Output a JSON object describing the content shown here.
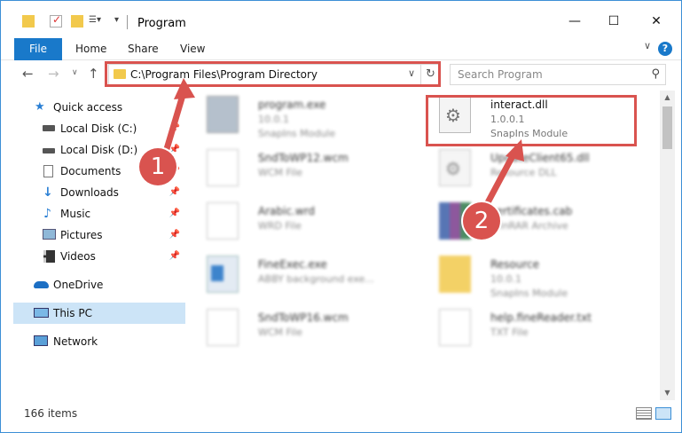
{
  "window": {
    "title": "Program",
    "minimize": "—",
    "maximize": "☐",
    "close": "✕"
  },
  "ribbon": {
    "tabs": [
      "File",
      "Home",
      "Share",
      "View"
    ],
    "help": "?"
  },
  "nav": {
    "address": "C:\\Program Files\\Program Directory",
    "search_placeholder": "Search Program"
  },
  "sidebar": {
    "items": [
      {
        "label": "Quick access",
        "icon": "star-icon",
        "pinned": false
      },
      {
        "label": "Local Disk (C:)",
        "icon": "drive-icon",
        "pinned": true
      },
      {
        "label": "Local Disk (D:)",
        "icon": "drive-icon",
        "pinned": true
      },
      {
        "label": "Documents",
        "icon": "documents-icon",
        "pinned": true
      },
      {
        "label": "Downloads",
        "icon": "download-icon",
        "pinned": true
      },
      {
        "label": "Music",
        "icon": "music-icon",
        "pinned": true
      },
      {
        "label": "Pictures",
        "icon": "pictures-icon",
        "pinned": true
      },
      {
        "label": "Videos",
        "icon": "videos-icon",
        "pinned": true
      },
      {
        "label": "OneDrive",
        "icon": "cloud-icon",
        "pinned": false
      },
      {
        "label": "This PC",
        "icon": "computer-icon",
        "pinned": false,
        "selected": true
      },
      {
        "label": "Network",
        "icon": "network-icon",
        "pinned": false
      }
    ]
  },
  "files": [
    {
      "name": "program.exe",
      "line1": "10.0.1",
      "line2": "SnapIns Module",
      "blurred": true
    },
    {
      "name": "interact.dll",
      "line1": "1.0.0.1",
      "line2": "SnapIns Module",
      "blurred": false
    },
    {
      "name": "SndToWP12.wcm",
      "line1": "WCM File",
      "line2": "",
      "blurred": true
    },
    {
      "name": "UpdateClient65.dll",
      "line1": "Resource DLL",
      "line2": "",
      "blurred": true
    },
    {
      "name": "Arabic.wrd",
      "line1": "WRD File",
      "line2": "",
      "blurred": true
    },
    {
      "name": "certificates.cab",
      "line1": "WinRAR Archive",
      "line2": "",
      "blurred": true
    },
    {
      "name": "FineExec.exe",
      "line1": "ABBY background exe...",
      "line2": "",
      "blurred": true
    },
    {
      "name": "Resource",
      "line1": "10.0.1",
      "line2": "SnapIns Module",
      "blurred": true
    },
    {
      "name": "SndToWP16.wcm",
      "line1": "WCM File",
      "line2": "",
      "blurred": true
    },
    {
      "name": "help.fineReader.txt",
      "line1": "TXT File",
      "line2": "",
      "blurred": true
    }
  ],
  "status": {
    "count": "166 items"
  },
  "annotations": {
    "marker1": "1",
    "marker2": "2",
    "color": "#d9534f"
  }
}
